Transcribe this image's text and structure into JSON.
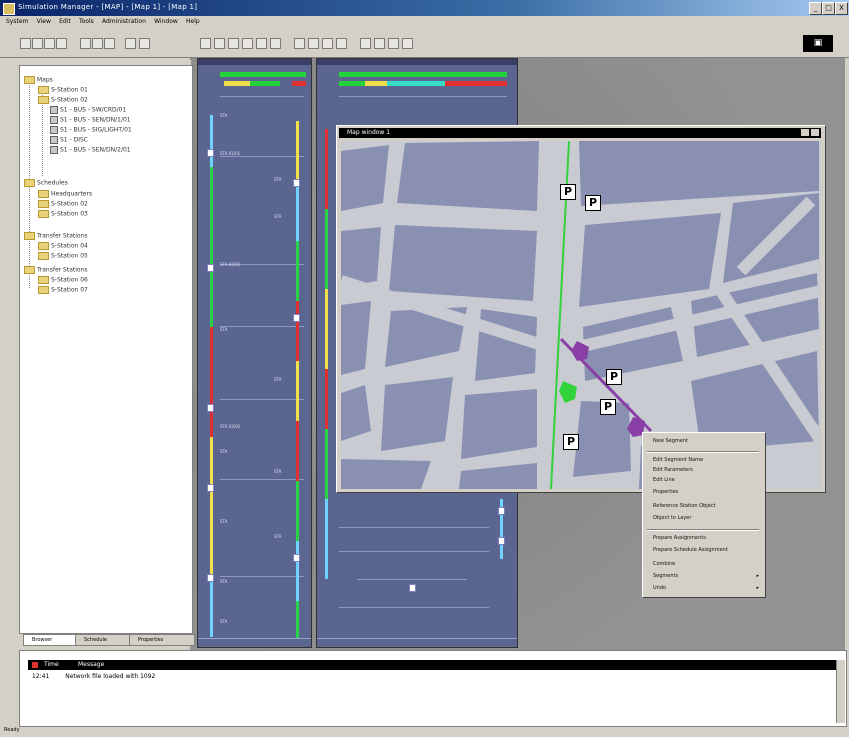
{
  "window": {
    "title": "Simulation Manager - [MAP] - [Map 1] - [Map 1]",
    "controls": [
      "_",
      "□",
      "X"
    ]
  },
  "menu": [
    "System",
    "View",
    "Edit",
    "Tools",
    "Administration",
    "Window",
    "Help"
  ],
  "toolbar": {
    "monitor_label": "▣"
  },
  "tree": {
    "root_label": "Maps",
    "items": [
      {
        "label": "S-Station 01",
        "type": "folder",
        "indent": 1
      },
      {
        "label": "S-Station 02",
        "type": "folder",
        "indent": 1
      },
      {
        "label": "S1 - BUS - SW/CRD/01",
        "type": "dev",
        "indent": 2
      },
      {
        "label": "S1 - BUS - SEN/DN/1/01",
        "type": "dev",
        "indent": 2
      },
      {
        "label": "S1 - BUS - SIG/LIGHT/01",
        "type": "dev",
        "indent": 2
      },
      {
        "label": "S1 - DISC",
        "type": "dev",
        "indent": 2
      },
      {
        "label": "S1 - BUS - SEN/DN/2/01",
        "type": "dev",
        "indent": 2
      },
      {
        "label": "Schedules",
        "type": "folder",
        "indent": 0
      },
      {
        "label": "Headquarters",
        "type": "folder",
        "indent": 1
      },
      {
        "label": "S-Station 02",
        "type": "folder",
        "indent": 1
      },
      {
        "label": "S-Station 03",
        "type": "folder",
        "indent": 1
      },
      {
        "label": "Transfer Stations",
        "type": "folder",
        "indent": 0
      },
      {
        "label": "S-Station 04",
        "type": "folder",
        "indent": 1
      },
      {
        "label": "S-Station 05",
        "type": "folder",
        "indent": 1
      },
      {
        "label": "Transfer Stations",
        "type": "folder",
        "indent": 0
      },
      {
        "label": "S-Station 06",
        "type": "folder",
        "indent": 1
      },
      {
        "label": "S-Station 07",
        "type": "folder",
        "indent": 1
      }
    ],
    "tabs": [
      "Browser",
      "Schedule",
      "Properties"
    ]
  },
  "graph_left": {
    "labels": [
      "STA",
      "STA 01/01",
      "STA",
      "STA",
      "STA 02/01",
      "STA",
      "STA",
      "STA 03/02",
      "STA",
      "STA",
      "STA",
      "STA",
      "STA",
      "STA"
    ]
  },
  "map": {
    "title": "Map window 1",
    "parking_label": "P"
  },
  "context_menu": {
    "items": [
      {
        "label": "New Segment",
        "arrow": false
      },
      {
        "label": "Edit Segment Name",
        "arrow": false
      },
      {
        "label": "Edit Parameters",
        "arrow": false
      },
      {
        "label": "Edit Line",
        "arrow": false
      },
      {
        "label": "Properties",
        "arrow": false
      },
      {
        "label": "Reference Station Object",
        "arrow": false
      },
      {
        "label": "Object to Layer",
        "arrow": false
      },
      {
        "label": "Prepare Assignments",
        "arrow": false
      },
      {
        "label": "Prepare Schedule Assignment",
        "arrow": false
      },
      {
        "label": "Combine",
        "arrow": false
      },
      {
        "label": "Segments",
        "arrow": true
      },
      {
        "label": "Undo",
        "arrow": true
      }
    ]
  },
  "messages": {
    "header_time": "Time",
    "header_message": "Message",
    "rows": [
      {
        "time": "12:41",
        "text": "Network file loaded with 1092"
      }
    ]
  },
  "status": {
    "text": "Ready"
  },
  "colors": {
    "graph_bg": "#5a6590",
    "map_block": "#8a90b2",
    "map_road": "#c9cbd3",
    "route_green": "#31d23a",
    "route_purple": "#8a3fa6"
  }
}
